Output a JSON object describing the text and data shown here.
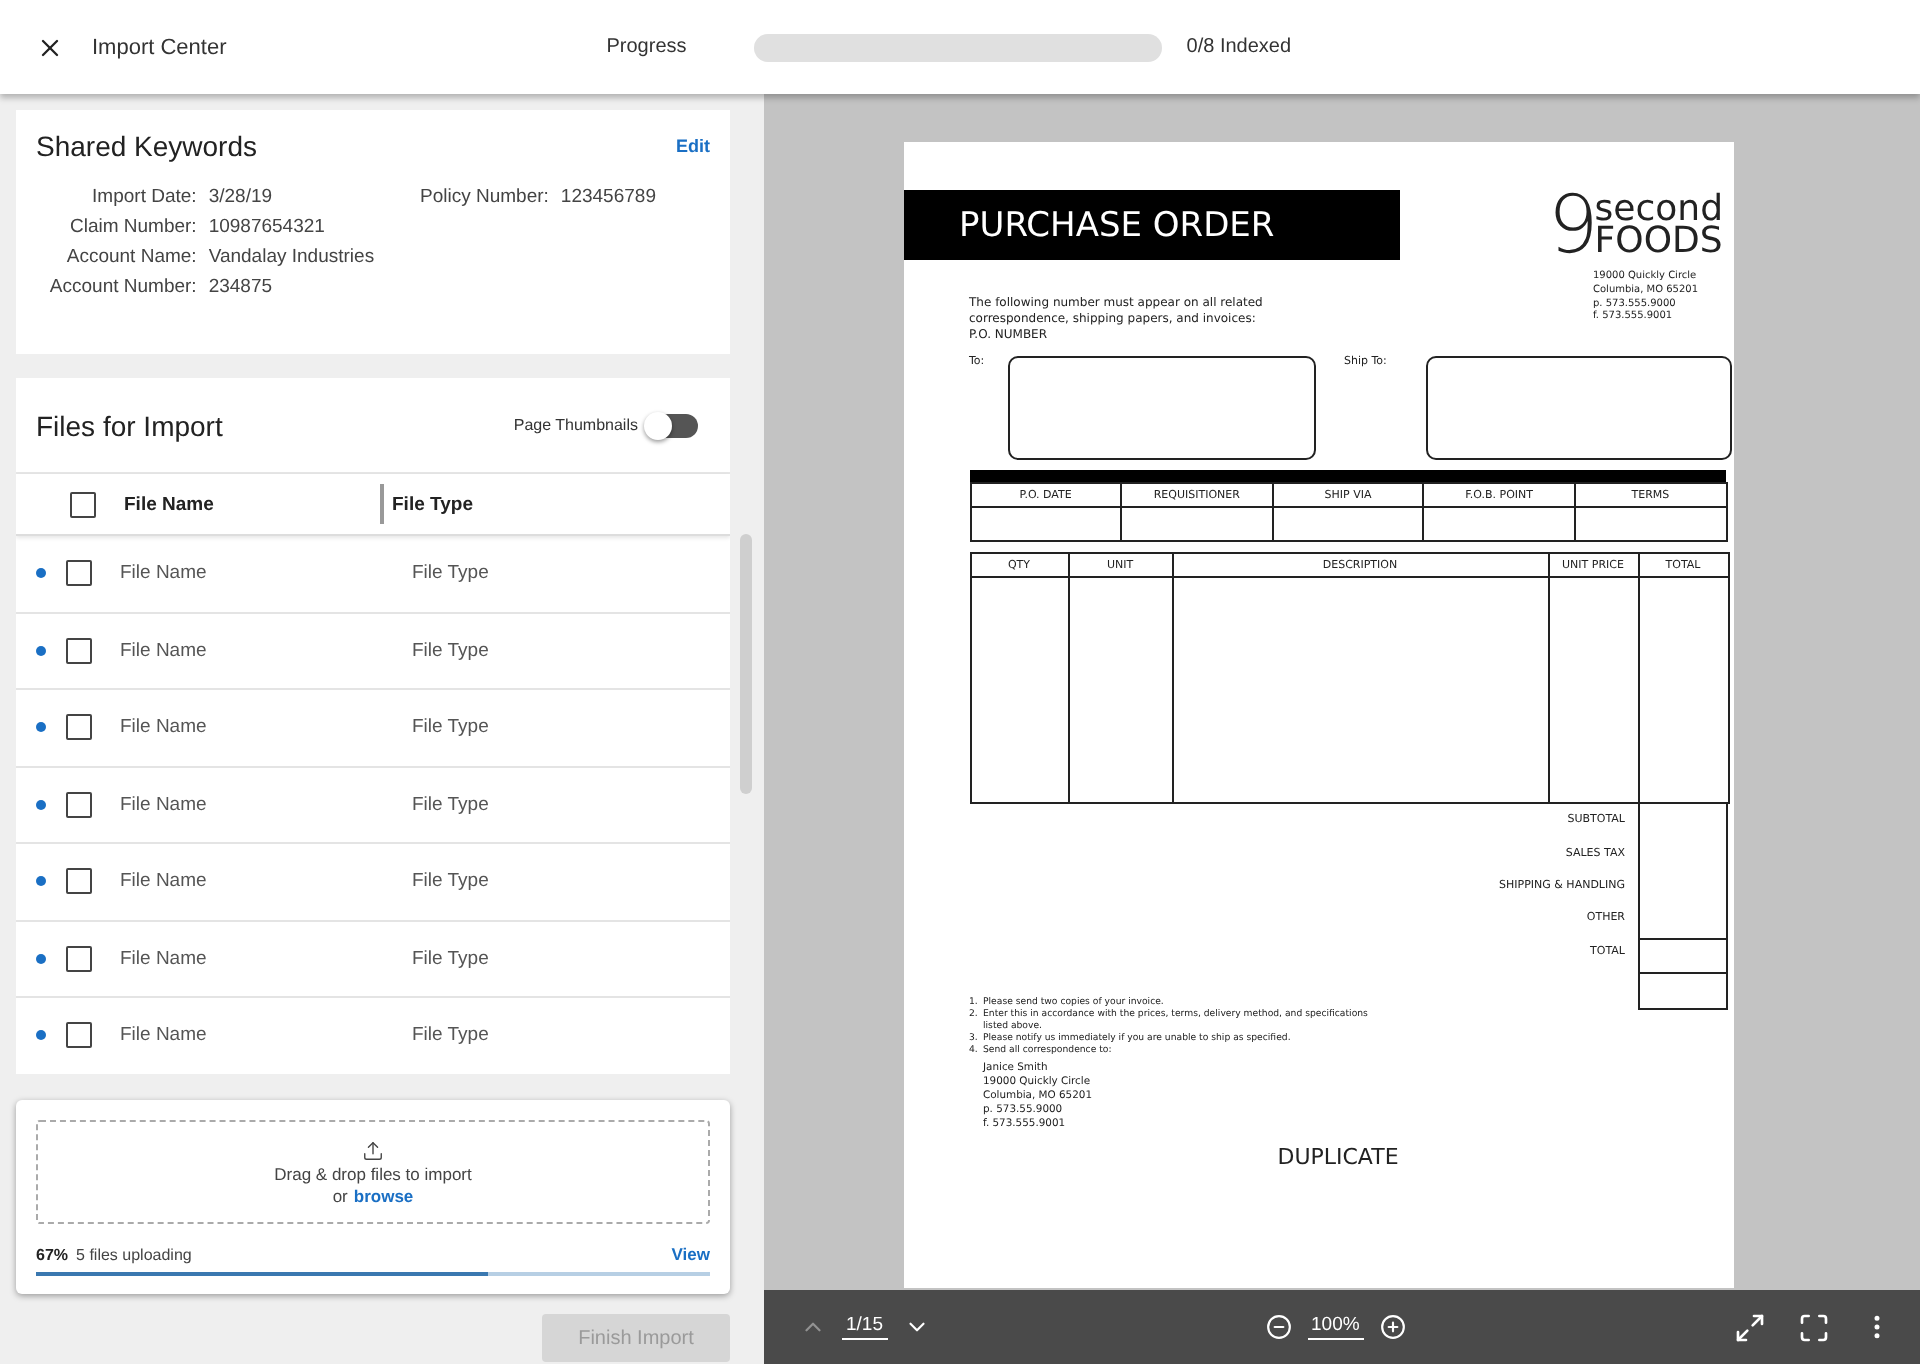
{
  "header": {
    "title": "Import Center",
    "progress_label": "Progress",
    "progress": {
      "level": 0
    },
    "progress_text": "0/8 Indexed"
  },
  "shared_keywords": {
    "title": "Shared Keywords",
    "edit": "Edit",
    "fields_left": [
      {
        "label": "Import Date:",
        "value": "3/28/19"
      },
      {
        "label": "Claim Number:",
        "value": "10987654321"
      },
      {
        "label": "Account Name:",
        "value": "Vandalay Industries"
      },
      {
        "label": "Account Number:",
        "value": "234875"
      }
    ],
    "fields_right": [
      {
        "label": "Policy Number:",
        "value": "123456789"
      }
    ]
  },
  "files": {
    "title": "Files for Import",
    "thumbnails_toggle": {
      "label": "Page Thumbnails",
      "on": false
    },
    "columns": [
      "File Name",
      "File Type"
    ],
    "all_checked": false,
    "rows": [
      {
        "name": "File Name",
        "type": "File Type",
        "checked": false,
        "unread": true
      },
      {
        "name": "File Name",
        "type": "File Type",
        "checked": false,
        "unread": true
      },
      {
        "name": "File Name",
        "type": "File Type",
        "checked": false,
        "unread": true
      },
      {
        "name": "File Name",
        "type": "File Type",
        "checked": false,
        "unread": true
      },
      {
        "name": "File Name",
        "type": "File Type",
        "checked": false,
        "unread": true
      },
      {
        "name": "File Name",
        "type": "File Type",
        "checked": false,
        "unread": true
      },
      {
        "name": "File Name",
        "type": "File Type",
        "checked": false,
        "unread": true
      }
    ]
  },
  "upload": {
    "hint": "Drag & drop files to import",
    "or": "or",
    "browse": "browse",
    "percent": "67%",
    "status": "5 files uploading",
    "view": "View",
    "level": 0.67
  },
  "finish_button": {
    "label": "Finish Import",
    "disabled": true
  },
  "document": {
    "title": "PURCHASE ORDER",
    "logo_digit": "9",
    "logo_top": "second",
    "logo_bottom": "FOODS",
    "address": [
      "19000 Quickly Circle",
      "Columbia, MO 65201",
      "p. 573.555.9000",
      "f. 573.555.9001"
    ],
    "notice": [
      "The following number must appear on all related",
      "correspondence, shipping papers, and invoices:",
      "P.O. NUMBER"
    ],
    "to_label": "To:",
    "ship_to_label": "Ship To:",
    "order_columns": [
      "P.O. DATE",
      "REQUISITIONER",
      "SHIP VIA",
      "F.O.B. POINT",
      "TERMS"
    ],
    "item_columns": [
      "QTY",
      "UNIT",
      "DESCRIPTION",
      "UNIT PRICE",
      "TOTAL"
    ],
    "totals": [
      "SUBTOTAL",
      "SALES TAX",
      "SHIPPING & HANDLING",
      "OTHER",
      "TOTAL"
    ],
    "instructions": [
      {
        "number": "1.",
        "text": "Please send two copies of your invoice."
      },
      {
        "number": "2.",
        "text": "Enter this in accordance with the prices, terms, delivery method, and specifications listed above."
      },
      {
        "number": "3.",
        "text": "Please notify us immediately if you are unable to ship as specified."
      },
      {
        "number": "4.",
        "text": "Send all correspondence to:"
      }
    ],
    "contact": [
      "Janice Smith",
      "19000 Quickly Circle",
      "Columbia, MO 65201",
      "p. 573.55.9000",
      "f. 573.555.9001"
    ],
    "stamp": "DUPLICATE"
  },
  "viewer_toolbar": {
    "page": "1/15",
    "zoom": "100%",
    "previous_disabled": true
  }
}
